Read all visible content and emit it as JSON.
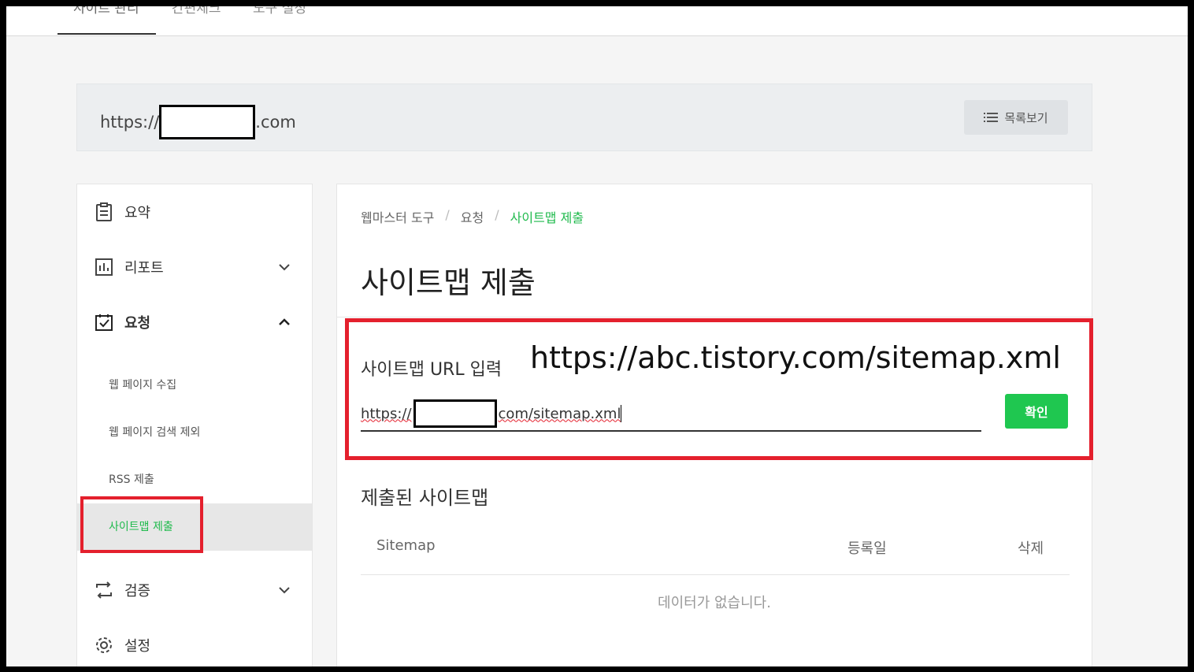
{
  "topbar": {
    "tabs": [
      "사이트 관리",
      "간편체크",
      "도구 설정"
    ]
  },
  "site_header": {
    "url_prefix": "https://",
    "url_suffix": ".com",
    "list_button_label": "목록보기"
  },
  "sidebar": {
    "items": [
      {
        "label": "요약",
        "icon": "clipboard-icon"
      },
      {
        "label": "리포트",
        "icon": "chart-icon"
      },
      {
        "label": "요청",
        "icon": "checkbox-icon"
      },
      {
        "label": "검증",
        "icon": "repeat-icon"
      },
      {
        "label": "설정",
        "icon": "gear-icon"
      }
    ],
    "sub_items": [
      "웹 페이지 수집",
      "웹 페이지 검색 제외",
      "RSS 제출",
      "사이트맵 제출"
    ]
  },
  "main": {
    "breadcrumb": [
      "웹마스터 도구",
      "요청",
      "사이트맵 제출"
    ],
    "title": "사이트맵 제출",
    "url_label": "사이트맵 URL 입력",
    "url_example": "https://abc.tistory.com/sitemap.xml",
    "input_prefix": "https://",
    "input_suffix": "com/sitemap.xml",
    "confirm_label": "확인",
    "submitted_title": "제출된 사이트맵",
    "table_headers": [
      "Sitemap",
      "등록일",
      "삭제"
    ],
    "empty_text": "데이터가 없습니다."
  },
  "colors": {
    "accent_green": "#1fba4c",
    "button_green": "#1fc750",
    "highlight_red": "#e4202d"
  }
}
